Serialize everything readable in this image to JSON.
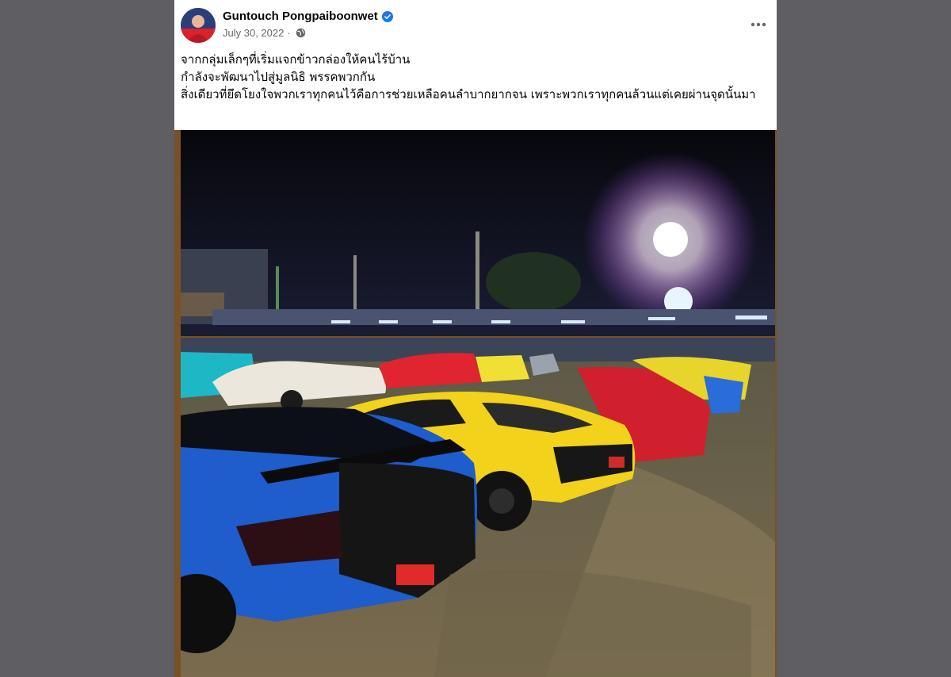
{
  "post": {
    "author": "Guntouch Pongpaiboonwet",
    "verified": true,
    "date": "July 30, 2022",
    "separator": "·",
    "audience_icon": "globe-icon",
    "more_icon": "more-options-icon",
    "caption_lines": [
      "จากกลุ่มเล็กๆที่เริ่มแจกข้าวกล่องให้คนไร้บ้าน",
      "กำลังจะพัฒนาไปสู่มูลนิธิ พรรคพวกกัน",
      "สิ่งเดียวที่ยึดโยงใจพวกเราทุกคนไว้คือการช่วยเหลือคนลำบากยากจน เพราะพวกเราทุกคนล้วนแต่เคยผ่านจุดนั้นมา"
    ],
    "photo": {
      "subject": "parking-lot-supercars-night"
    }
  },
  "colors": {
    "page_bg": "#5f5e63",
    "card_bg": "#ffffff",
    "verified_blue": "#1877f2",
    "meta_gray": "#65676b",
    "text": "#050505"
  }
}
